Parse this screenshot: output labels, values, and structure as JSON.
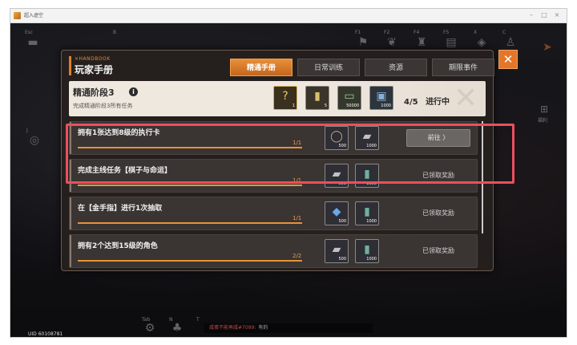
{
  "window": {
    "title": "超入虚空",
    "min": "–",
    "max": "□",
    "close": "×"
  },
  "hud": {
    "keys": [
      "Esc",
      "B",
      "F1",
      "F2",
      "F4",
      "F5",
      "X",
      "C",
      "J",
      "Tab",
      "N",
      "T"
    ],
    "right_label": "福利",
    "uid": "UID 60108781",
    "chat_name": "咸蛋不能再咸#7099:",
    "chat_text": "有的"
  },
  "panel": {
    "tag": "✕HANDBOOK",
    "title": "玩家手册",
    "close_label": "✕",
    "tabs": [
      {
        "label": "精通手册",
        "active": true
      },
      {
        "label": "日常训练",
        "active": false
      },
      {
        "label": "资源",
        "active": false
      },
      {
        "label": "期限事件",
        "active": false
      }
    ]
  },
  "stage": {
    "title": "精通阶段3",
    "subtitle": "完成精通阶段3所有任务",
    "progress": "4/5",
    "status": "进行中",
    "rewards": [
      {
        "icon": "mystery-card-icon",
        "qty": "1"
      },
      {
        "icon": "card-pack-icon",
        "qty": "5"
      },
      {
        "icon": "cash-icon",
        "qty": "50000"
      },
      {
        "icon": "data-chip-icon",
        "qty": "1000"
      }
    ]
  },
  "tasks": [
    {
      "label": "拥有1张达到8级的执行卡",
      "count": "1/1",
      "progress": 1.0,
      "rewards": [
        {
          "icon": "ring-icon",
          "qty": "500"
        },
        {
          "icon": "ingot-icon",
          "qty": "1000"
        }
      ],
      "action": "前往 〉",
      "action_type": "goto"
    },
    {
      "label": "完成主线任务【棋子与命运】",
      "count": "1/1",
      "progress": 1.0,
      "rewards": [
        {
          "icon": "ingot-icon",
          "qty": "500"
        },
        {
          "icon": "battery-icon",
          "qty": "1000"
        }
      ],
      "action": "已领取奖励",
      "action_type": "claimed"
    },
    {
      "label": "在【金手指】进行1次抽取",
      "count": "1/1",
      "progress": 1.0,
      "rewards": [
        {
          "icon": "crystal-icon",
          "qty": "500"
        },
        {
          "icon": "battery-icon",
          "qty": "1000"
        }
      ],
      "action": "已领取奖励",
      "action_type": "claimed"
    },
    {
      "label": "拥有2个达到15级的角色",
      "count": "2/2",
      "progress": 1.0,
      "rewards": [
        {
          "icon": "ingot-icon",
          "qty": "500"
        },
        {
          "icon": "battery-icon",
          "qty": "1000"
        }
      ],
      "action": "已领取奖励",
      "action_type": "claimed"
    }
  ],
  "colors": {
    "accent": "#e7913a",
    "highlight": "#ec4f5e"
  }
}
